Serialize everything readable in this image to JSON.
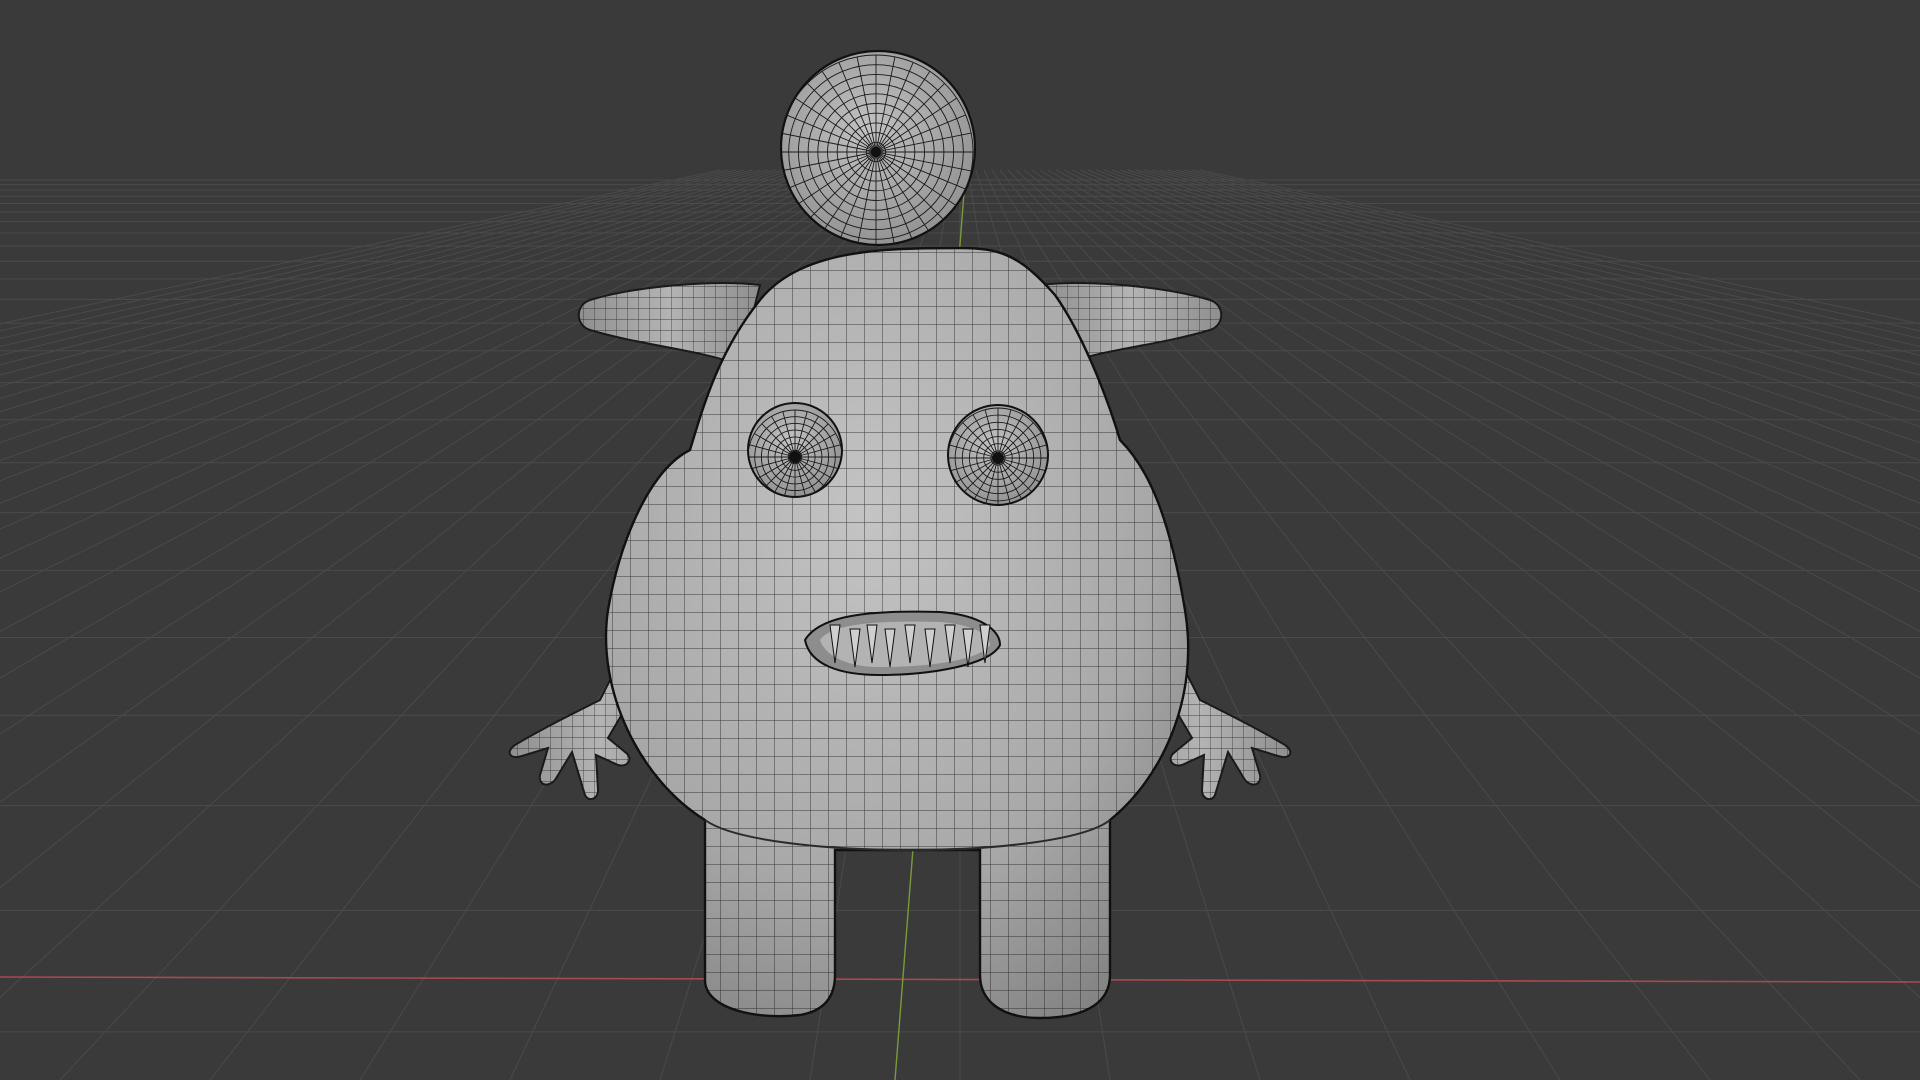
{
  "app": {
    "name": "3D viewport",
    "view": "perspective",
    "shading": "solid",
    "overlays": {
      "wireframe": true,
      "floor_grid": true,
      "x_axis_line": true,
      "y_axis_line": true
    }
  },
  "colors": {
    "background": "#3a3a3a",
    "grid_line": "#4a4a4a",
    "x_axis": "#a8494f",
    "y_axis": "#7a9a3a",
    "mesh_fill": "#a9a9a9",
    "mesh_light": "#bdbdbd",
    "mesh_dark": "#7f7f7f",
    "wire": "#1a1a1a"
  },
  "scene": {
    "object": {
      "kind": "cartoon-monster",
      "parts": [
        "head-ball",
        "body",
        "left-horn",
        "right-horn",
        "left-eye",
        "right-eye",
        "mouth-teeth",
        "left-arm",
        "right-arm",
        "left-leg",
        "right-leg"
      ]
    }
  }
}
